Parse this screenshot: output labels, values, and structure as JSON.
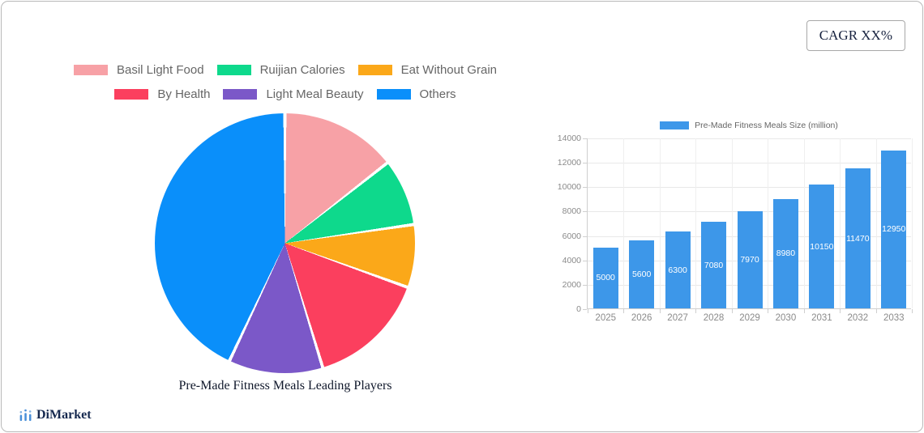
{
  "cagr_box": {
    "label": "CAGR XX%"
  },
  "brand": {
    "name": "DiMarket",
    "icon": "bar-chart-logo-icon",
    "icon_color": "#4a90d9"
  },
  "chart_data": [
    {
      "type": "pie",
      "title": "Pre-Made Fitness Meals Leading Players",
      "legend_position": "top",
      "start_angle_deg": 0,
      "direction": "clockwise",
      "slice_gap_deg": 1.4,
      "slices": [
        {
          "label": "Basil Light Food",
          "value_pct": 14.4,
          "color": "#F7A1A6"
        },
        {
          "label": "Ruijian Calories",
          "value_pct": 8.3,
          "color": "#0ED98C"
        },
        {
          "label": "Eat Without Grain",
          "value_pct": 7.8,
          "color": "#FBA819"
        },
        {
          "label": "By Health",
          "value_pct": 14.8,
          "color": "#FB3F5E"
        },
        {
          "label": "Light Meal Beauty",
          "value_pct": 11.7,
          "color": "#7B58C8"
        },
        {
          "label": "Others",
          "value_pct": 43.0,
          "color": "#0A8FFA"
        }
      ],
      "legend_rows": [
        [
          0,
          1,
          2
        ],
        [
          3,
          4,
          5
        ]
      ]
    },
    {
      "type": "bar",
      "legend_label": "Pre-Made Fitness Meals Size (million)",
      "categories": [
        "2025",
        "2026",
        "2027",
        "2028",
        "2029",
        "2030",
        "2031",
        "2032",
        "2033"
      ],
      "values": [
        5000,
        5600,
        6300,
        7080,
        7970,
        8980,
        10150,
        11470,
        12950
      ],
      "bar_color": "#3D97E9",
      "ylim": [
        0,
        14000
      ],
      "y_ticks": [
        0,
        2000,
        4000,
        6000,
        8000,
        10000,
        12000,
        14000
      ],
      "grid": true,
      "value_labels": "inside-white"
    }
  ]
}
